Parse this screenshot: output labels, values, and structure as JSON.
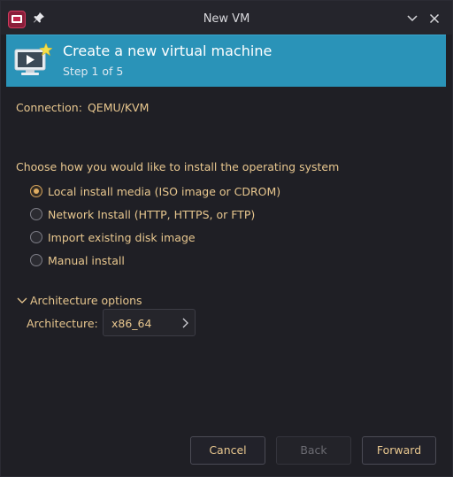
{
  "window": {
    "title": "New VM"
  },
  "header": {
    "title": "Create a new virtual machine",
    "step": "Step 1 of 5"
  },
  "connection": {
    "label": "Connection:",
    "value": "QEMU/KVM"
  },
  "install": {
    "prompt": "Choose how you would like to install the operating system",
    "options": [
      {
        "label": "Local install media (ISO image or CDROM)",
        "selected": true
      },
      {
        "label": "Network Install (HTTP, HTTPS, or FTP)",
        "selected": false
      },
      {
        "label": "Import existing disk image",
        "selected": false
      },
      {
        "label": "Manual install",
        "selected": false
      }
    ]
  },
  "architecture": {
    "section_label": "Architecture options",
    "label": "Architecture:",
    "value": "x86_64",
    "expanded": true
  },
  "buttons": {
    "cancel": "Cancel",
    "back": "Back",
    "forward": "Forward",
    "back_enabled": false
  },
  "colors": {
    "banner": "#2a93b8",
    "text_accent": "#e8c78f",
    "window_bg": "#1f1f25",
    "radio_selected": "#e0ad62"
  },
  "icons": {
    "app": "virt-manager-icon",
    "pin": "pin-icon",
    "minimize": "chevron-down-icon",
    "close": "close-icon",
    "banner": "new-vm-monitor-icon",
    "expander": "chevron-down-icon",
    "combo": "chevron-right-icon"
  }
}
